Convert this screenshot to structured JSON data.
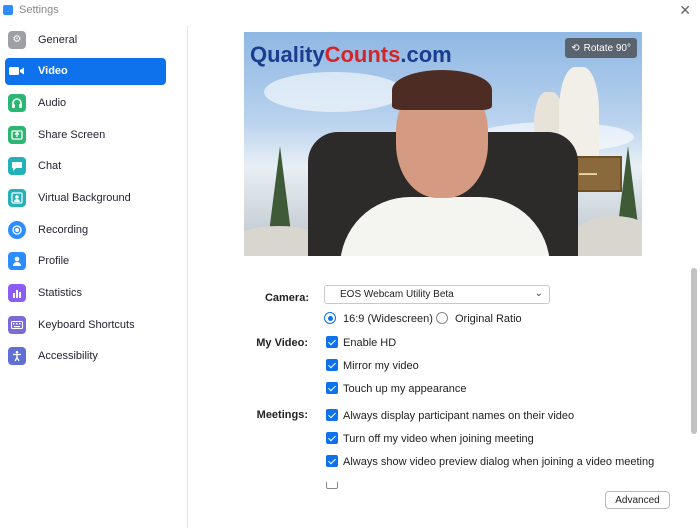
{
  "window": {
    "title": "Settings"
  },
  "sidebar": {
    "items": [
      {
        "label": "General",
        "color": "#9ea0a5",
        "glyph": "⚙"
      },
      {
        "label": "Video",
        "color": "#ffffff",
        "glyph": "■",
        "active": true
      },
      {
        "label": "Audio",
        "color": "#2bb673",
        "glyph": "◠"
      },
      {
        "label": "Share Screen",
        "color": "#2bb673",
        "glyph": "↑"
      },
      {
        "label": "Chat",
        "color": "#22b2b7",
        "glyph": "▬"
      },
      {
        "label": "Virtual Background",
        "color": "#22b2b7",
        "glyph": "▣"
      },
      {
        "label": "Recording",
        "color": "#2d8cff",
        "glyph": "◉"
      },
      {
        "label": "Profile",
        "color": "#2d8cff",
        "glyph": "●"
      },
      {
        "label": "Statistics",
        "color": "#8b5cf6",
        "glyph": "▮"
      },
      {
        "label": "Keyboard Shortcuts",
        "color": "#7c6bd6",
        "glyph": "▦"
      },
      {
        "label": "Accessibility",
        "color": "#5f6fd3",
        "glyph": "✦"
      }
    ]
  },
  "preview": {
    "logo_main": "Quality",
    "logo_red": "Counts",
    "logo_tld": ".com",
    "rotate_label": "Rotate 90°"
  },
  "camera": {
    "label": "Camera:",
    "selected": "EOS Webcam Utility Beta",
    "ratio_options": [
      {
        "label": "16:9 (Widescreen)",
        "selected": true
      },
      {
        "label": "Original Ratio",
        "selected": false
      }
    ]
  },
  "my_video": {
    "label": "My Video:",
    "options": [
      {
        "label": "Enable HD",
        "checked": true
      },
      {
        "label": "Mirror my video",
        "checked": true
      },
      {
        "label": "Touch up my appearance",
        "checked": true
      }
    ]
  },
  "meetings": {
    "label": "Meetings:",
    "options": [
      {
        "label": "Always display participant names on their video",
        "checked": true
      },
      {
        "label": "Turn off my video when joining meeting",
        "checked": true
      },
      {
        "label": "Always show video preview dialog when joining a video meeting",
        "checked": true
      }
    ]
  },
  "advanced_label": "Advanced"
}
